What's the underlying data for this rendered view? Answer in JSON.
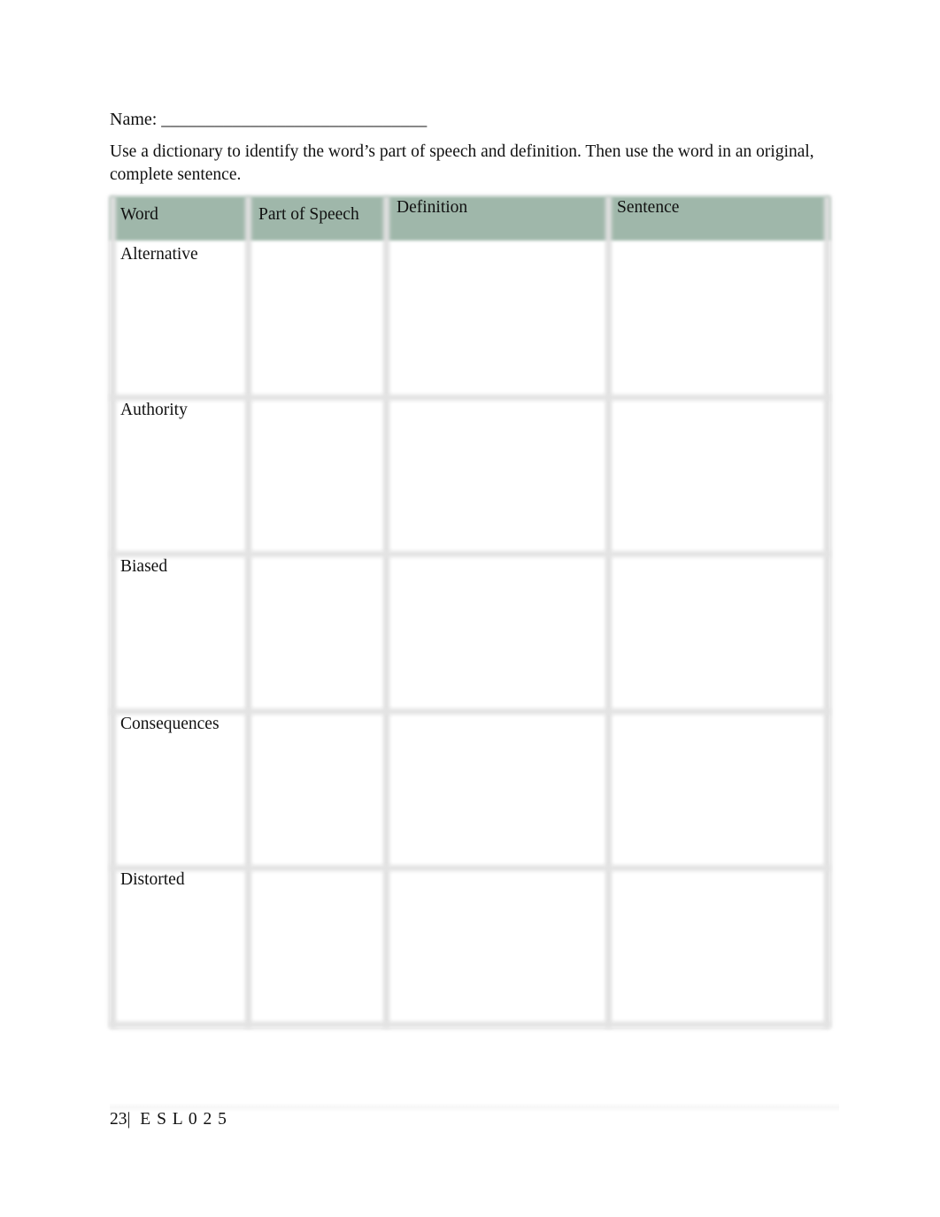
{
  "header": {
    "name_label": "Name: ______________________________"
  },
  "instructions": "Use a dictionary to identify the word’s part of speech and   definition. Then use the word in an original, complete sentence.",
  "table": {
    "columns": [
      "Word",
      "Part of Speech",
      "Definition",
      "Sentence"
    ],
    "rows": [
      {
        "word": "Alternative",
        "part_of_speech": "",
        "definition": "",
        "sentence": ""
      },
      {
        "word": "Authority",
        "part_of_speech": "",
        "definition": "",
        "sentence": ""
      },
      {
        "word": "Biased",
        "part_of_speech": "",
        "definition": "",
        "sentence": ""
      },
      {
        "word": "Consequences",
        "part_of_speech": "",
        "definition": "",
        "sentence": ""
      },
      {
        "word": "Distorted",
        "part_of_speech": "",
        "definition": "",
        "sentence": ""
      }
    ],
    "header_color": "#9fb7aa"
  },
  "footer": {
    "page_number": "23",
    "separator": "|",
    "course": "E S L 0 2 5"
  }
}
